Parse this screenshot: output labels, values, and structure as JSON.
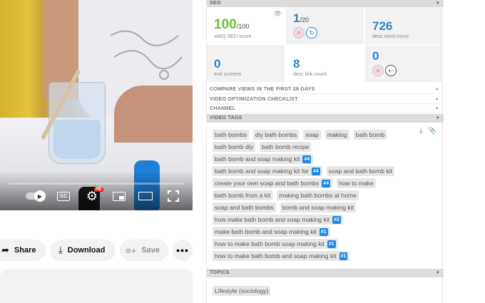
{
  "player": {
    "controls": {
      "cc_label": "CC",
      "hd_badge": "HD"
    },
    "icons": [
      "autoplay-toggle-icon",
      "captions-icon",
      "settings-gear-icon",
      "miniplayer-icon",
      "theater-mode-icon",
      "fullscreen-icon"
    ]
  },
  "actions": {
    "share_label": "Share",
    "download_label": "Download",
    "save_label": "Save",
    "more_label": "•••"
  },
  "seo": {
    "header": "SEO",
    "score": {
      "value": "100",
      "max": "/100",
      "caption": "vidIQ SEO score"
    },
    "rank": {
      "value": "1",
      "suffix": "/20"
    },
    "desc_word_count": {
      "value": "726",
      "caption": "desc word count"
    },
    "end_screens": {
      "value": "0",
      "caption": "end screens"
    },
    "desc_link_count": {
      "value": "8",
      "caption": "desc link count"
    },
    "cards": {
      "value": "0"
    },
    "colors": {
      "score_green": "#6fbd3c",
      "value_blue": "#2b86cd",
      "rank_badge": "#1e88e5"
    }
  },
  "sections": {
    "compare_views": "COMPARE VIEWS IN THE FIRST 28 DAYS",
    "optimization_checklist": "VIDEO OPTIMIZATION CHECKLIST",
    "channel": "CHANNEL",
    "video_tags": "VIDEO TAGS",
    "topics": "TOPICS"
  },
  "tag_lines": [
    [
      {
        "text": "bath bombs"
      },
      {
        "text": "diy bath bombs"
      },
      {
        "text": "soap"
      },
      {
        "text": "making"
      },
      {
        "text": "bath bomb"
      }
    ],
    [
      {
        "text": "bath bomb diy"
      },
      {
        "text": "bath bomb recipe"
      }
    ],
    [
      {
        "text": "bath bomb and soap making kit",
        "rank": "#4"
      }
    ],
    [
      {
        "text": "bath bomb and soap making kit for",
        "rank": "#4"
      },
      {
        "text": "soap and bath bomb kit"
      }
    ],
    [
      {
        "text": "create your own soap and bath bombs",
        "rank": "#4"
      },
      {
        "text": "how to make"
      }
    ],
    [
      {
        "text": "bath bomb from a kit"
      },
      {
        "text": "making bath bombs at home"
      }
    ],
    [
      {
        "text": "soap and bath bombs"
      },
      {
        "text": "bomb and soap making kit"
      }
    ],
    [
      {
        "text": "how make bath bomb and soap making kit",
        "rank": "#2"
      }
    ],
    [
      {
        "text": "make bath bomb and soap making kit",
        "rank": "#1"
      }
    ],
    [
      {
        "text": "how to make bath bomb soap making kit",
        "rank": "#1"
      }
    ],
    [
      {
        "text": "how to make bath bomb and soap making kit",
        "rank": "#1"
      }
    ]
  ],
  "topics": [
    "Lifestyle (sociology)"
  ]
}
